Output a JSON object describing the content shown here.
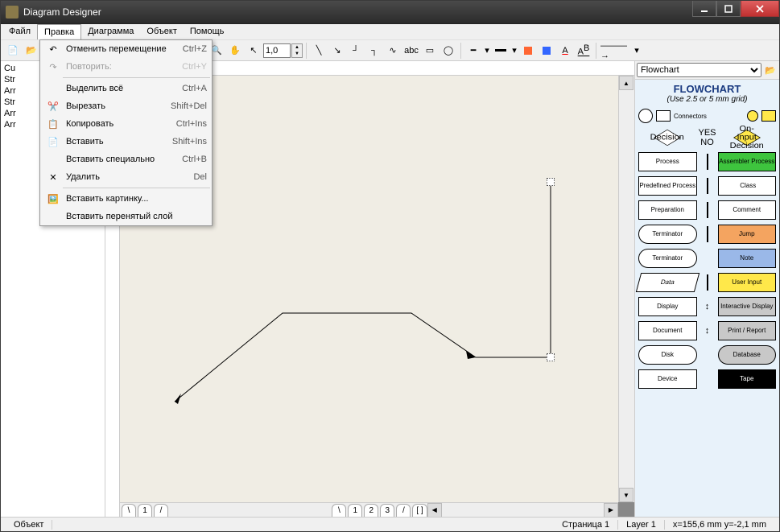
{
  "window": {
    "title": "Diagram Designer"
  },
  "menubar": [
    "Файл",
    "Правка",
    "Диаграмма",
    "Объект",
    "Помощь"
  ],
  "menubar_open_index": 1,
  "edit_menu": [
    {
      "icon": "undo",
      "label": "Отменить перемещение",
      "shortcut": "Ctrl+Z"
    },
    {
      "icon": "redo",
      "label": "Повторить:",
      "shortcut": "Ctrl+Y",
      "disabled": true
    },
    {
      "sep": true
    },
    {
      "icon": "",
      "label": "Выделить всё",
      "shortcut": "Ctrl+A"
    },
    {
      "icon": "cut",
      "label": "Вырезать",
      "shortcut": "Shift+Del"
    },
    {
      "icon": "copy",
      "label": "Копировать",
      "shortcut": "Ctrl+Ins"
    },
    {
      "icon": "paste",
      "label": "Вставить",
      "shortcut": "Shift+Ins"
    },
    {
      "icon": "",
      "label": "Вставить специально",
      "shortcut": "Ctrl+B"
    },
    {
      "icon": "delete",
      "label": "Удалить",
      "shortcut": "Del"
    },
    {
      "sep": true
    },
    {
      "icon": "picture",
      "label": "Вставить картинку..."
    },
    {
      "icon": "",
      "label": "Вставить перенятый слой"
    }
  ],
  "toolbar": {
    "zoom": "1,0"
  },
  "tree": [
    "Cu",
    "Str",
    "Arr",
    "Str",
    "Arr",
    "Arr"
  ],
  "pages": [
    "1",
    "2",
    "3"
  ],
  "palette": {
    "selector": "Flowchart",
    "title": "FLOWCHART",
    "subtitle": "(Use 2.5 or 5 mm grid)",
    "connectors": "Connectors",
    "yes": "YES",
    "no": "NO",
    "shapes": {
      "decision": "Decision",
      "oninput": "On-Input Decision",
      "process": "Process",
      "assembler": "Assembler Process",
      "predef": "Predefined Process",
      "class": "Class",
      "prep": "Preparation",
      "comment": "Comment",
      "terminator": "Terminator",
      "jump": "Jump",
      "terminator2": "Terminator",
      "note": "Note",
      "data": "Data",
      "userinput": "User Input",
      "display": "Display",
      "idisplay": "Interactive Display",
      "document": "Document",
      "print": "Print / Report",
      "disk": "Disk",
      "database": "Database",
      "device": "Device",
      "tape": "Tape"
    }
  },
  "status": {
    "left": "Объект",
    "page": "Страница 1",
    "layer": "Layer 1",
    "coords": "x=155,6 mm  y=-2,1 mm"
  }
}
